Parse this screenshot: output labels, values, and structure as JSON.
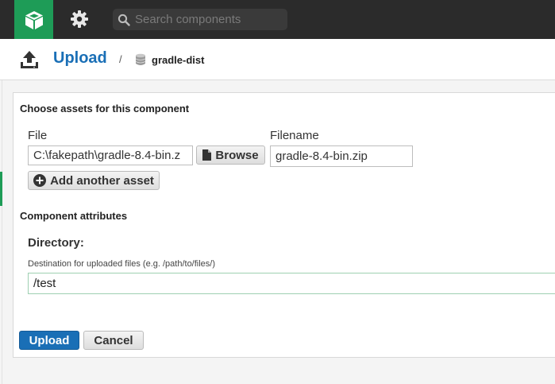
{
  "topbar": {
    "search_placeholder": "Search components",
    "logo_icon": "cube-icon",
    "settings_icon": "gear-icon",
    "search_icon": "search-icon",
    "accent_color": "#1e9c57"
  },
  "header": {
    "title": "Upload",
    "separator": "/",
    "repository": "gradle-dist"
  },
  "form": {
    "assets_title": "Choose assets for this component",
    "file_label": "File",
    "file_value": "C:\\fakepath\\gradle-8.4-bin.z",
    "browse_label": "Browse",
    "filename_label": "Filename",
    "filename_value": "gradle-8.4-bin.zip",
    "add_asset_label": "Add another asset",
    "attributes_title": "Component attributes",
    "directory_label": "Directory:",
    "directory_help": "Destination for uploaded files (e.g. /path/to/files/)",
    "directory_value": "/test",
    "upload_label": "Upload",
    "cancel_label": "Cancel",
    "primary_color": "#1a6fb6"
  }
}
